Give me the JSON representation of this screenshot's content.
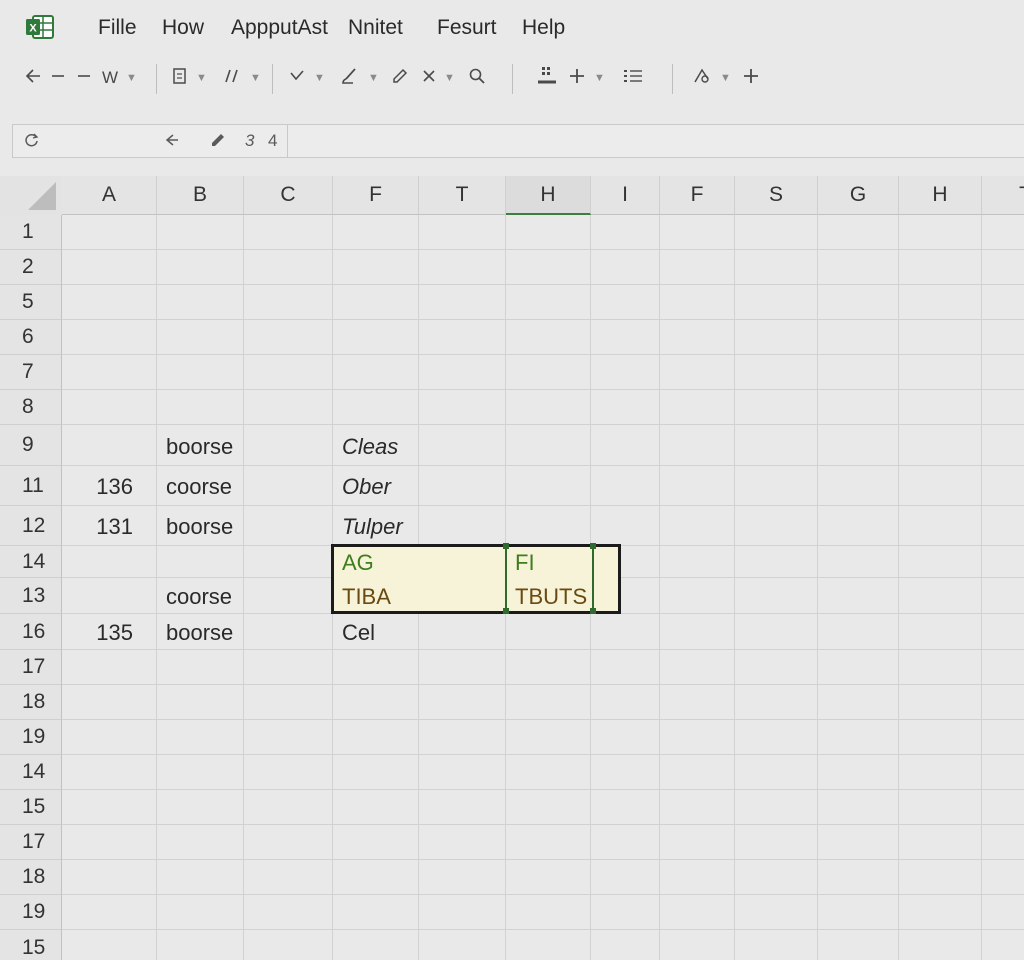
{
  "menu": {
    "items": [
      "Fille",
      "How",
      "AppputAst",
      "Nnitet",
      "Fesurt",
      "Help"
    ]
  },
  "toolbar": {
    "font_label": "W"
  },
  "formula_bar": {
    "cell_values": [
      "3",
      "4"
    ]
  },
  "grid": {
    "columns": [
      "A",
      "B",
      "C",
      "F",
      "T",
      "H",
      "I",
      "F",
      "S",
      "G",
      "H",
      "T"
    ],
    "active_column": 5,
    "rows": [
      "1",
      "2",
      "5",
      "6",
      "7",
      "8",
      "9",
      "11",
      "12",
      "14",
      "13",
      "16",
      "17",
      "18",
      "19",
      "14",
      "15",
      "17",
      "18",
      "19",
      "15"
    ],
    "cells": [
      {
        "row": 6,
        "col": 1,
        "text": "boorse"
      },
      {
        "row": 6,
        "col": 3,
        "text": "Cleas",
        "style": "italic"
      },
      {
        "row": 7,
        "col": 0,
        "text": "136",
        "style": "num"
      },
      {
        "row": 7,
        "col": 1,
        "text": "coorse"
      },
      {
        "row": 7,
        "col": 3,
        "text": "Ober",
        "style": "italic"
      },
      {
        "row": 8,
        "col": 0,
        "text": "131",
        "style": "num"
      },
      {
        "row": 8,
        "col": 1,
        "text": "boorse"
      },
      {
        "row": 8,
        "col": 3,
        "text": "Tulper",
        "style": "italic"
      },
      {
        "row": 9,
        "col": 3,
        "text": "AG",
        "style": "green"
      },
      {
        "row": 9,
        "col": 5,
        "text": "FI",
        "style": "green"
      },
      {
        "row": 10,
        "col": 1,
        "text": "coorse"
      },
      {
        "row": 10,
        "col": 3,
        "text": "TIBA",
        "style": "brown"
      },
      {
        "row": 10,
        "col": 5,
        "text": "TBUTS",
        "style": "brown"
      },
      {
        "row": 11,
        "col": 0,
        "text": "135",
        "style": "num"
      },
      {
        "row": 11,
        "col": 1,
        "text": "boorse"
      },
      {
        "row": 11,
        "col": 3,
        "text": "Cel"
      }
    ]
  },
  "icons": {
    "logo": "spreadsheet-logo-icon"
  }
}
